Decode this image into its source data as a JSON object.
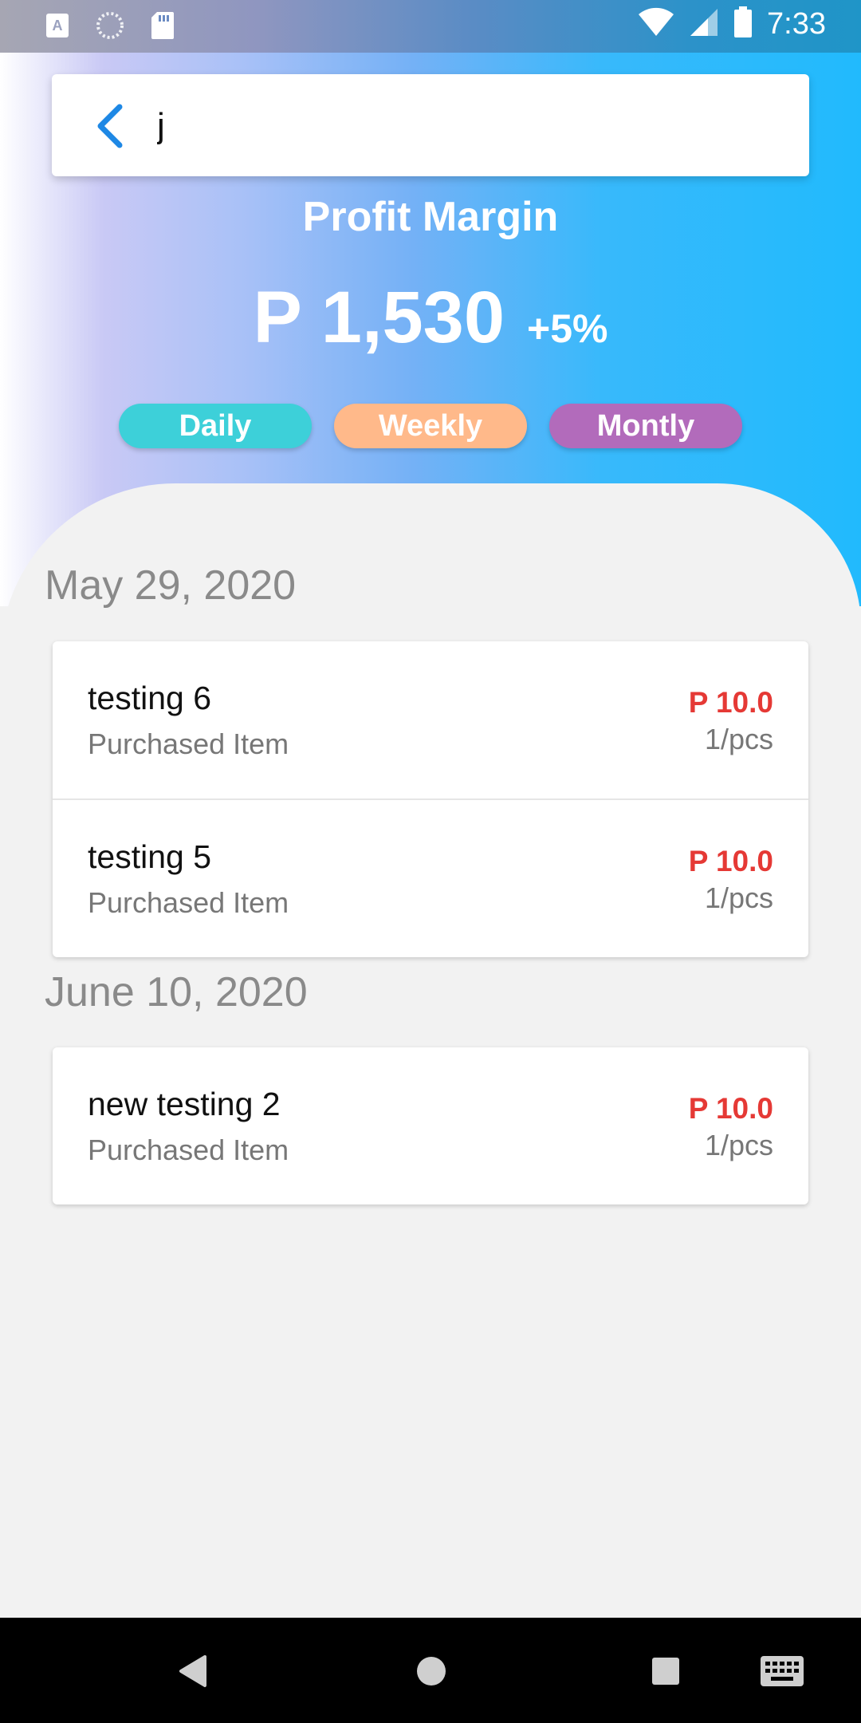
{
  "status_bar": {
    "time": "7:33",
    "left_icons": [
      "text-icon",
      "loading-icon",
      "sd-card-icon"
    ],
    "right_icons": [
      "wifi-icon",
      "signal-icon",
      "battery-icon"
    ]
  },
  "search": {
    "value": "j",
    "placeholder": ""
  },
  "summary": {
    "title": "Profit Margin",
    "amount": "P 1,530",
    "change": "+5%"
  },
  "filters": [
    {
      "label": "Daily",
      "color": "#3dd0d9"
    },
    {
      "label": "Weekly",
      "color": "#ffb98a"
    },
    {
      "label": "Montly",
      "color": "#b26bbb"
    }
  ],
  "groups": [
    {
      "date": "May 29, 2020",
      "items": [
        {
          "name": "testing 6",
          "type": "Purchased Item",
          "price": "P 10.0",
          "qty": "1/pcs"
        },
        {
          "name": "testing 5",
          "type": "Purchased Item",
          "price": "P 10.0",
          "qty": "1/pcs"
        }
      ]
    },
    {
      "date": "June 10, 2020",
      "items": [
        {
          "name": "new testing 2",
          "type": "Purchased Item",
          "price": "P 10.0",
          "qty": "1/pcs"
        }
      ]
    }
  ],
  "colors": {
    "accent": "#1e88e5",
    "price": "#e53935",
    "hero_end": "#21bafd"
  },
  "nav_bar": [
    "back-icon",
    "home-icon",
    "recents-icon",
    "keyboard-icon"
  ]
}
